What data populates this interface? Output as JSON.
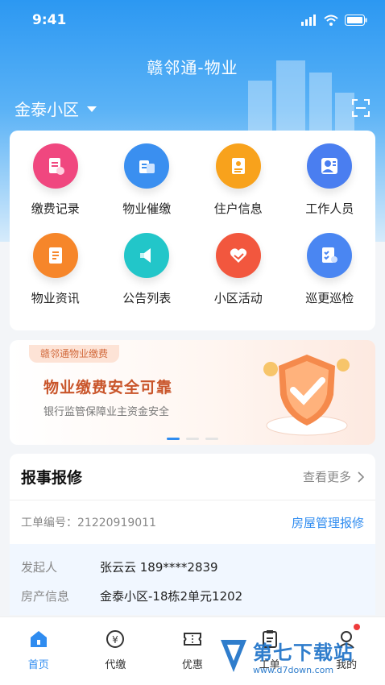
{
  "status_bar": {
    "time": "9:41"
  },
  "header": {
    "title": "赣邻通-物业",
    "community": "金泰小区"
  },
  "services": [
    {
      "label": "缴费记录",
      "icon": "payment-record-icon",
      "color": "#f0477f"
    },
    {
      "label": "物业催缴",
      "icon": "payment-reminder-icon",
      "color": "#3a8ff0"
    },
    {
      "label": "住户信息",
      "icon": "resident-info-icon",
      "color": "#f8a21c"
    },
    {
      "label": "工作人员",
      "icon": "staff-icon",
      "color": "#4a7ef0"
    },
    {
      "label": "物业资讯",
      "icon": "news-icon",
      "color": "#f6862a"
    },
    {
      "label": "公告列表",
      "icon": "announcement-icon",
      "color": "#22c6c9"
    },
    {
      "label": "小区活动",
      "icon": "activity-icon",
      "color": "#f2573e"
    },
    {
      "label": "巡更巡检",
      "icon": "patrol-icon",
      "color": "#4a86f2"
    }
  ],
  "banner": {
    "tag": "赣邻通物业缴费",
    "title": "物业缴费安全可靠",
    "subtitle": "银行监管保障业主资金安全"
  },
  "repair": {
    "title": "报事报修",
    "more": "查看更多",
    "order_no": "工单编号：21220919011",
    "order_type": "房屋管理报修",
    "rows": [
      {
        "key": "发起人",
        "value": "张云云  189****2839"
      },
      {
        "key": "房产信息",
        "value": "金泰小区-18栋2单元1202"
      }
    ]
  },
  "tabs": [
    {
      "label": "首页",
      "icon": "home-icon",
      "active": true
    },
    {
      "label": "代缴",
      "icon": "pay-icon"
    },
    {
      "label": "优惠",
      "icon": "coupon-icon"
    },
    {
      "label": "工单",
      "icon": "work-order-icon"
    },
    {
      "label": "我的",
      "icon": "profile-icon"
    }
  ],
  "watermark": {
    "text": "第七下载站",
    "url": "www.d7down.com"
  },
  "colors": {
    "primary": "#2f8cf0",
    "banner_title": "#c9552a"
  }
}
